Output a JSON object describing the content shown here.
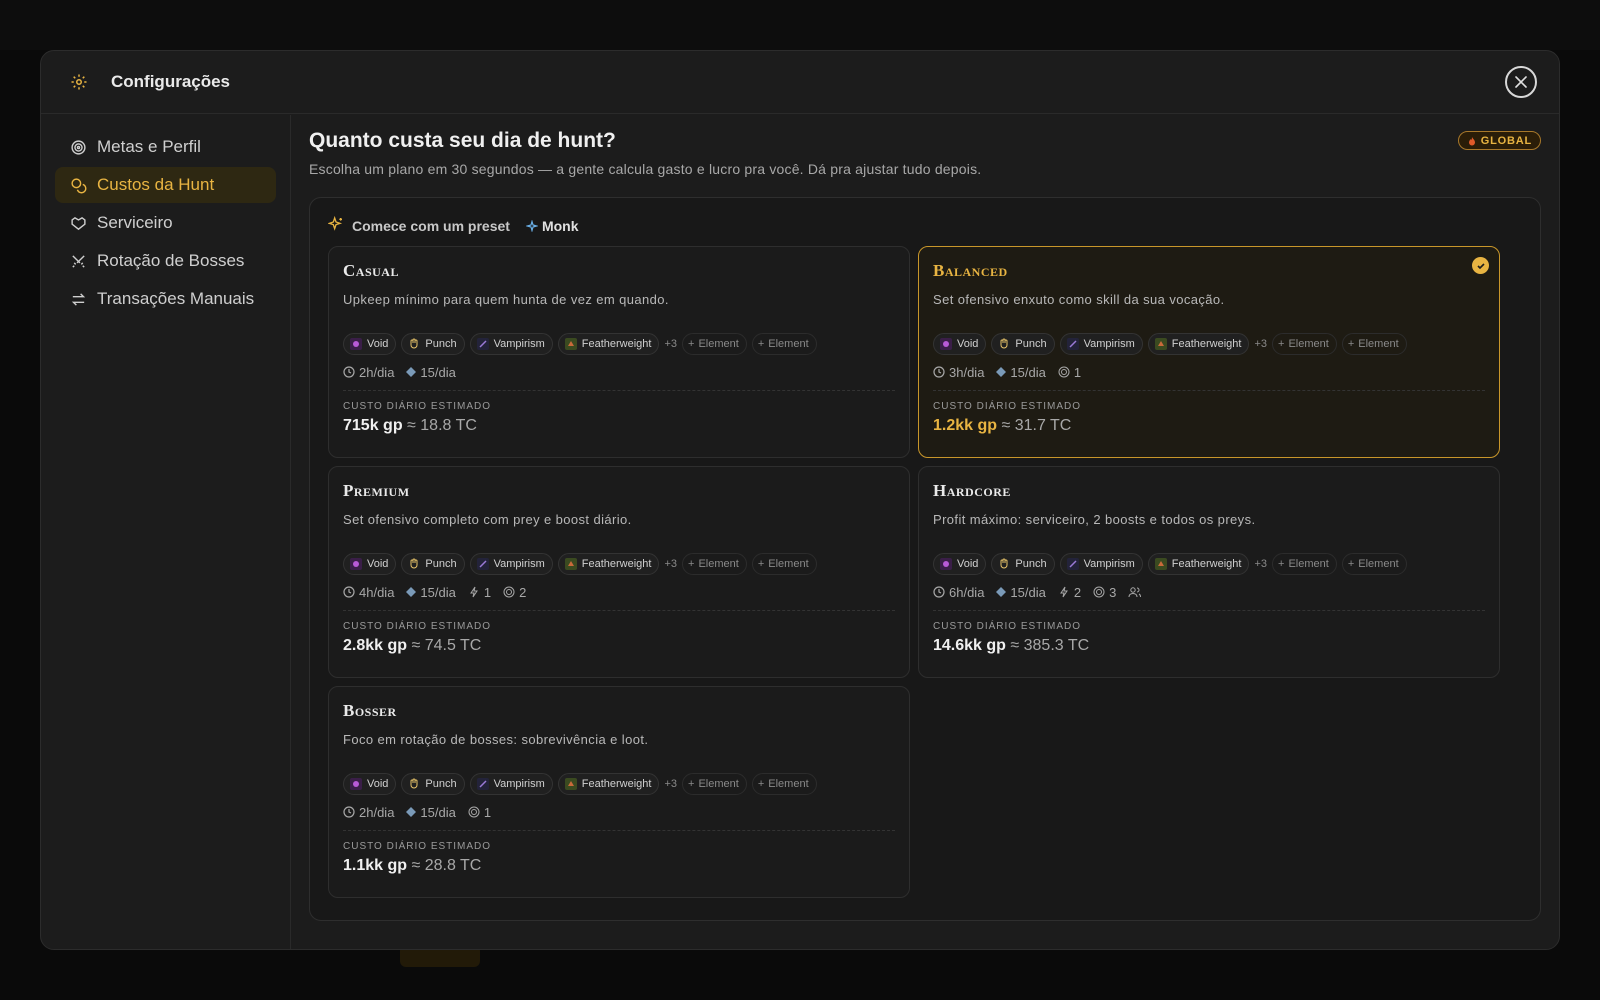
{
  "modal": {
    "title": "Configurações"
  },
  "sidebar": {
    "items": [
      {
        "label": "Metas e Perfil",
        "icon": "target-icon"
      },
      {
        "label": "Custos da Hunt",
        "icon": "coins-icon",
        "active": true
      },
      {
        "label": "Serviceiro",
        "icon": "handshake-icon"
      },
      {
        "label": "Rotação de Bosses",
        "icon": "swords-icon"
      },
      {
        "label": "Transações Manuais",
        "icon": "transfer-icon"
      }
    ]
  },
  "main": {
    "title": "Quanto custa seu dia de hunt?",
    "subtitle": "Escolha um plano em 30 segundos — a gente calcula gasto e lucro pra você. Dá pra ajustar tudo depois.",
    "badge": "GLOBAL",
    "preset_label": "Comece com um preset",
    "vocation": "Monk"
  },
  "common": {
    "cost_label": "CUSTO DIÁRIO ESTIMADO",
    "chips": [
      "Void",
      "Punch",
      "Vampirism",
      "Featherweight"
    ],
    "more": "+3",
    "element": "Element"
  },
  "cards": [
    {
      "title": "Casual",
      "desc": "Upkeep mínimo para quem hunta de vez em quando.",
      "hours": "2h/dia",
      "gems": "15/dia",
      "boosts": null,
      "preys": null,
      "party": false,
      "gp": "715k gp",
      "tc": "≈ 18.8 TC",
      "selected": false
    },
    {
      "title": "Balanced",
      "desc": "Set ofensivo enxuto como skill da sua vocação.",
      "hours": "3h/dia",
      "gems": "15/dia",
      "boosts": null,
      "preys": "1",
      "party": false,
      "gp": "1.2kk gp",
      "tc": "≈ 31.7 TC",
      "selected": true
    },
    {
      "title": "Premium",
      "desc": "Set ofensivo completo com prey e boost diário.",
      "hours": "4h/dia",
      "gems": "15/dia",
      "boosts": "1",
      "preys": "2",
      "party": false,
      "gp": "2.8kk gp",
      "tc": "≈ 74.5 TC",
      "selected": false
    },
    {
      "title": "Hardcore",
      "desc": "Profit máximo: serviceiro, 2 boosts e todos os preys.",
      "hours": "6h/dia",
      "gems": "15/dia",
      "boosts": "2",
      "preys": "3",
      "party": true,
      "gp": "14.6kk gp",
      "tc": "≈ 385.3 TC",
      "selected": false
    },
    {
      "title": "Bosser",
      "desc": "Foco em rotação de bosses: sobrevivência e loot.",
      "hours": "2h/dia",
      "gems": "15/dia",
      "boosts": null,
      "preys": "1",
      "party": false,
      "gp": "1.1kk gp",
      "tc": "≈ 28.8 TC",
      "selected": false
    }
  ],
  "colors": {
    "accent": "#e8b442",
    "background": "#1c1c1c"
  }
}
